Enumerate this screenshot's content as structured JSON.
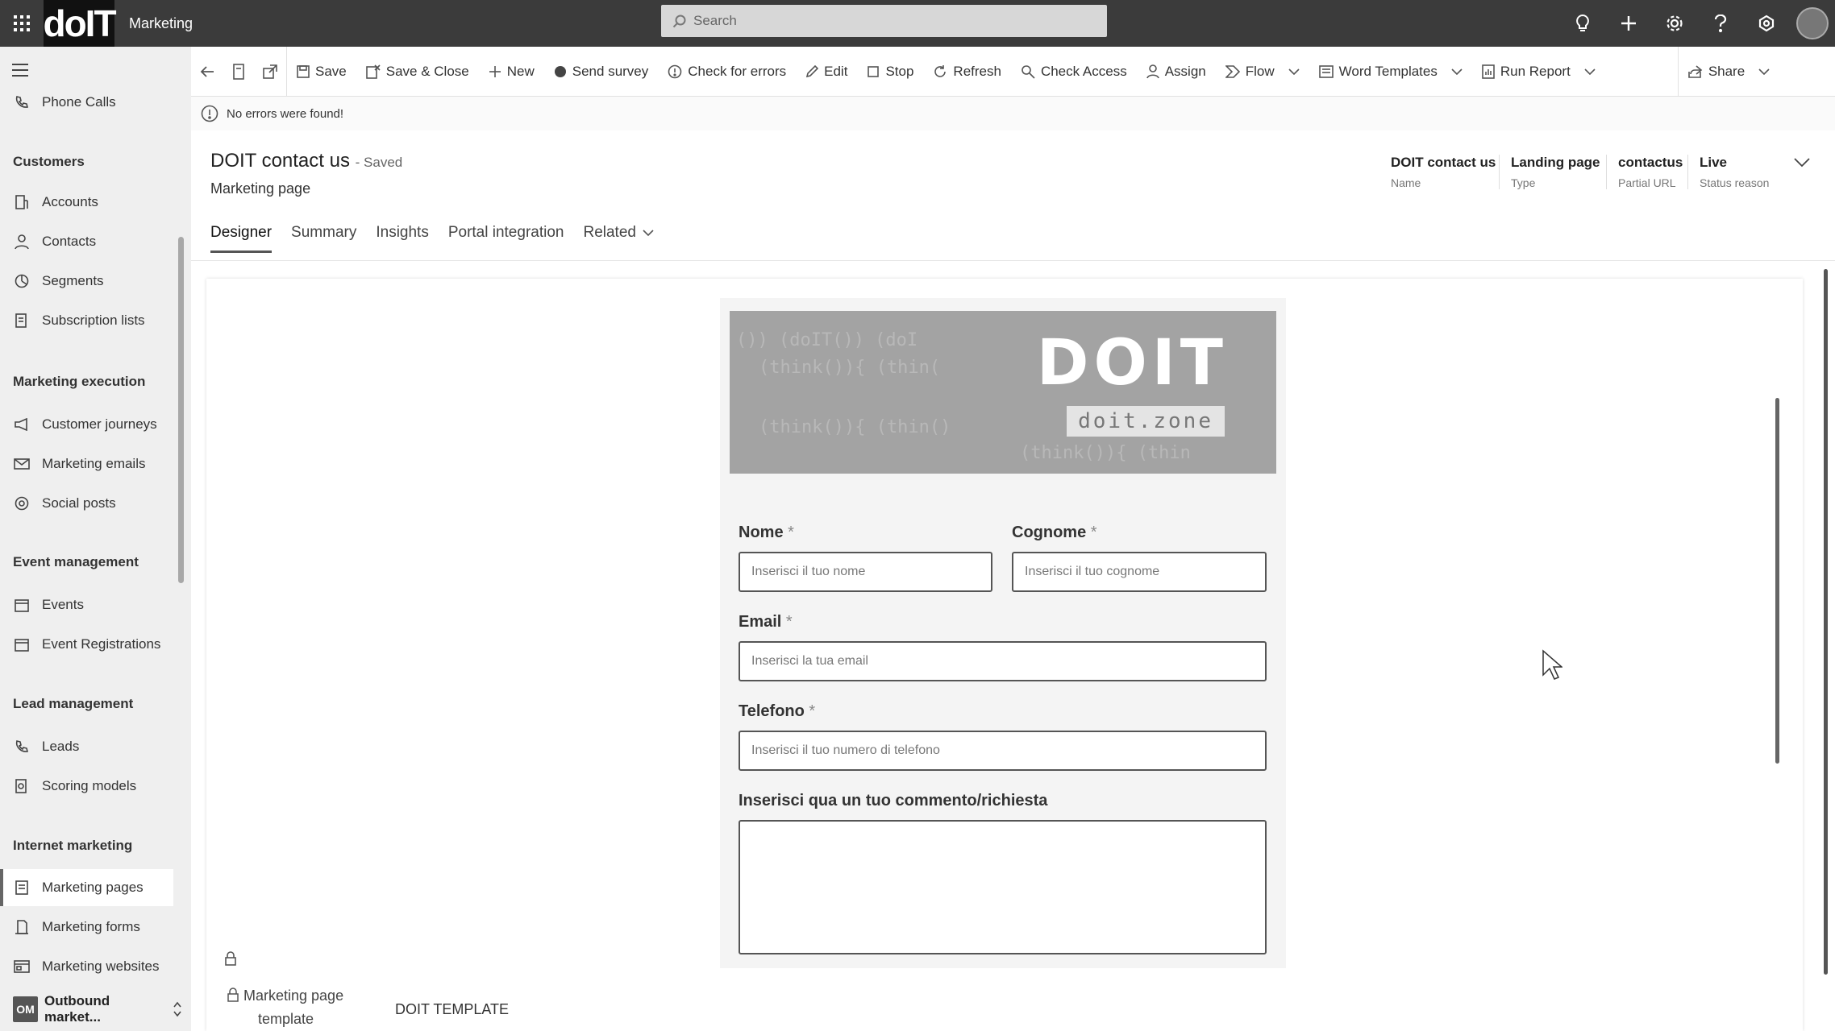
{
  "topbar": {
    "app_name": "Marketing",
    "logo_text": "doIT",
    "search_placeholder": "Search"
  },
  "sidebar": {
    "top_item": "Phone Calls",
    "groups": [
      {
        "label": "Customers",
        "items": [
          "Accounts",
          "Contacts",
          "Segments",
          "Subscription lists"
        ]
      },
      {
        "label": "Marketing execution",
        "items": [
          "Customer journeys",
          "Marketing emails",
          "Social posts"
        ]
      },
      {
        "label": "Event management",
        "items": [
          "Events",
          "Event Registrations"
        ]
      },
      {
        "label": "Lead management",
        "items": [
          "Leads",
          "Scoring models"
        ]
      },
      {
        "label": "Internet marketing",
        "items": [
          "Marketing pages",
          "Marketing forms",
          "Marketing websites"
        ]
      }
    ],
    "area_badge": "OM",
    "area_label": "Outbound market..."
  },
  "commandbar": {
    "save": "Save",
    "save_close": "Save & Close",
    "new": "New",
    "send_survey": "Send survey",
    "check_errors": "Check for errors",
    "edit": "Edit",
    "stop": "Stop",
    "refresh": "Refresh",
    "check_access": "Check Access",
    "assign": "Assign",
    "flow": "Flow",
    "word_templates": "Word Templates",
    "run_report": "Run Report",
    "share": "Share"
  },
  "notification": "No errors were found!",
  "header": {
    "title": "DOIT contact us",
    "saved": "- Saved",
    "subtitle": "Marketing page",
    "fields": [
      {
        "value": "DOIT contact us",
        "label": "Name"
      },
      {
        "value": "Landing page",
        "label": "Type"
      },
      {
        "value": "contactus",
        "label": "Partial URL"
      },
      {
        "value": "Live",
        "label": "Status reason"
      }
    ]
  },
  "tabs": [
    "Designer",
    "Summary",
    "Insights",
    "Portal integration",
    "Related"
  ],
  "banner": {
    "title": "DOIT",
    "subtitle": "doit.zone",
    "code_lines": [
      "()) (doIT()) (doI",
      "(think()){ (thin(",
      "(think()){ (thin()",
      "(think()){ (thin"
    ]
  },
  "form": {
    "nome": {
      "label": "Nome",
      "placeholder": "Inserisci il tuo nome"
    },
    "cognome": {
      "label": "Cognome",
      "placeholder": "Inserisci il tuo cognome"
    },
    "email": {
      "label": "Email",
      "placeholder": "Inserisci la tua email"
    },
    "telefono": {
      "label": "Telefono",
      "placeholder": "Inserisci il tuo numero di telefono"
    },
    "commento": {
      "label": "Inserisci qua un tuo commento/richiesta"
    },
    "required_mark": "*"
  },
  "footer": {
    "template_label_1": "Marketing page",
    "template_label_2": "template",
    "template_value": "DOIT TEMPLATE"
  }
}
